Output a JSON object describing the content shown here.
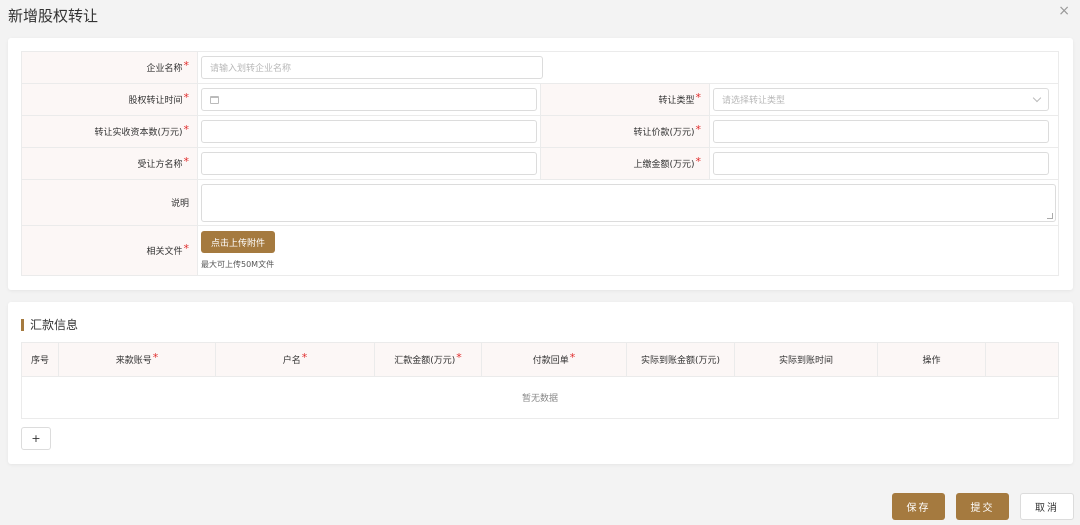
{
  "dialog": {
    "title": "新增股权转让",
    "close": "×"
  },
  "form": {
    "company_label": "企业名称",
    "company_placeholder": "请输入划转企业名称",
    "transfer_time_label": "股权转让时间",
    "transfer_type_label": "转让类型",
    "transfer_type_placeholder": "请选择转让类型",
    "capital_label": "转让实收资本数(万元)",
    "price_label": "转让价款(万元)",
    "transferee_label": "受让方名称",
    "paid_amount_label": "上缴金额(万元)",
    "remark_label": "说明",
    "files_label": "相关文件",
    "upload_button": "点击上传附件",
    "upload_hint": "最大可上传50M文件",
    "required_mark": "*"
  },
  "remittance": {
    "title": "汇款信息",
    "columns": [
      "序号",
      "来款账号",
      "户名",
      "汇款金额(万元)",
      "付款回单",
      "实际到账金额(万元)",
      "实际到账时间",
      "操作"
    ],
    "empty_text": "暂无数据",
    "add_button": "+"
  },
  "footer": {
    "save": "保存",
    "submit": "提交",
    "cancel": "取消"
  },
  "colors": {
    "accent": "#a57a3f",
    "label_bg": "#fcf7f6",
    "required": "#e02b2b"
  }
}
